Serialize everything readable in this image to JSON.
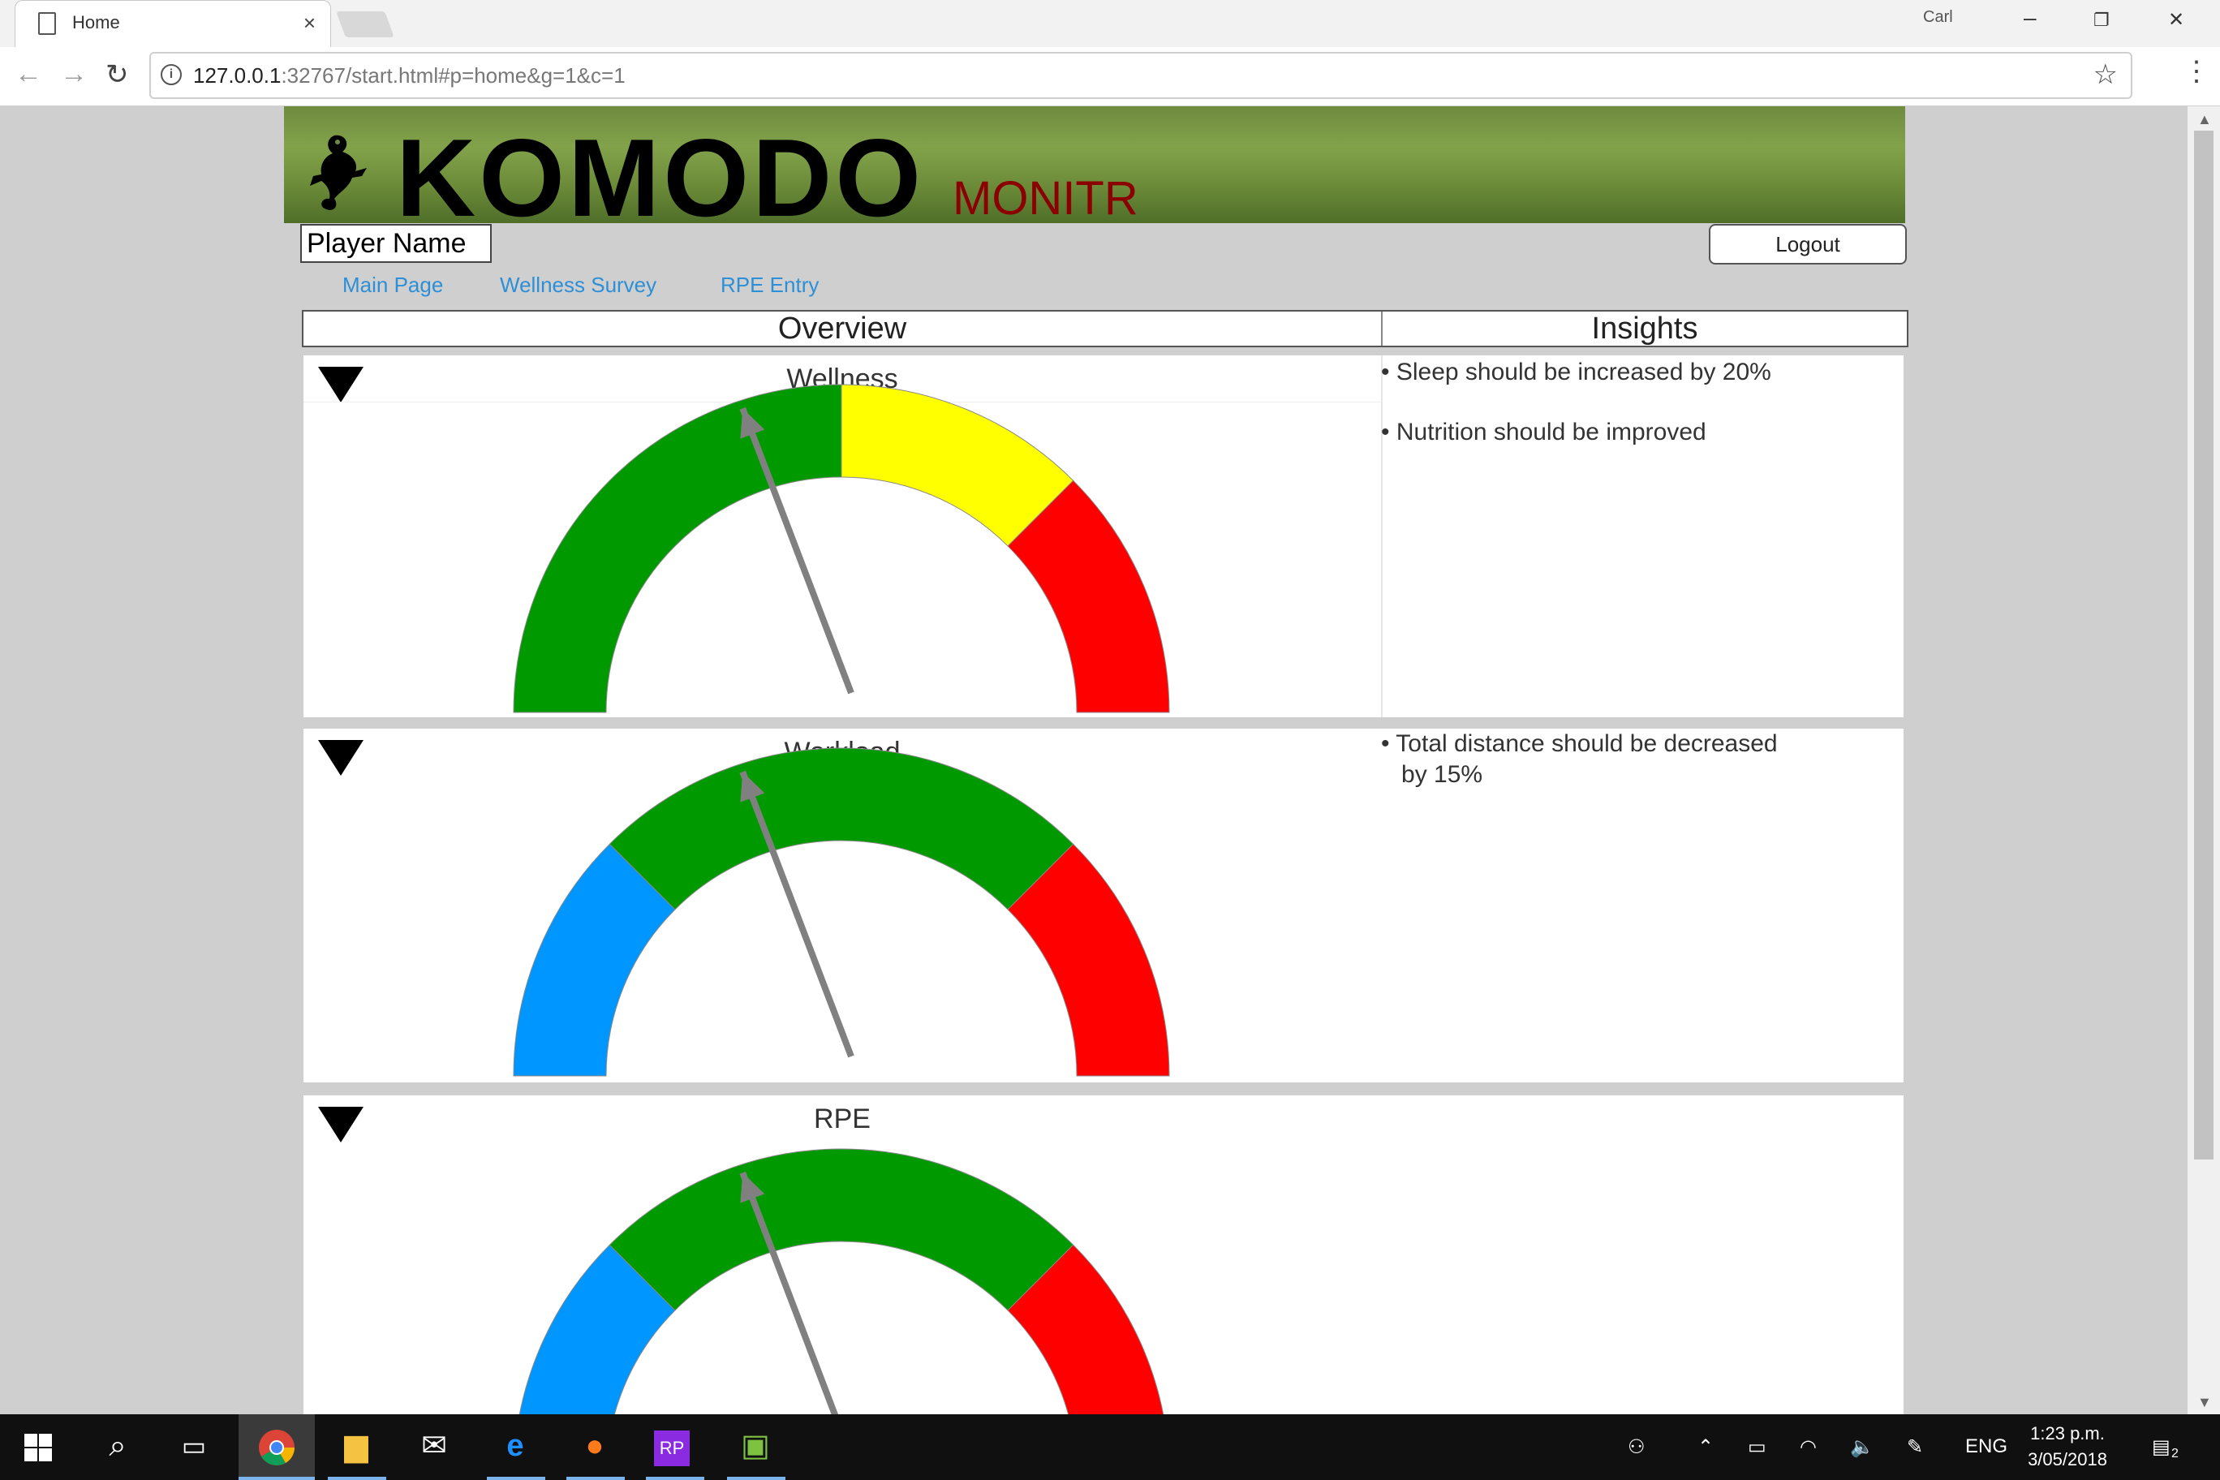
{
  "browser": {
    "tab_title": "Home",
    "tab_close": "×",
    "profile": "Carl",
    "url_host": "127.0.0.1",
    "url_rest": ":32767/start.html#p=home&g=1&c=1",
    "window_min": "–",
    "window_restore": "❐",
    "window_close": "✕",
    "back": "←",
    "forward": "→",
    "reload": "↻",
    "bookmark_star": "☆",
    "menu": "⋮"
  },
  "header": {
    "brand": "KOMODO",
    "sub": "MONITR",
    "player_name": "Player Name",
    "logout": "Logout"
  },
  "nav": {
    "items": [
      {
        "label": "Main Page"
      },
      {
        "label": "Wellness Survey"
      },
      {
        "label": "RPE Entry"
      }
    ]
  },
  "columns": {
    "overview": "Overview",
    "insights": "Insights"
  },
  "panels": [
    {
      "title": "Wellness",
      "needle_fraction": 0.4,
      "bands": [
        {
          "color": "#009900",
          "from": 0.0,
          "to": 0.5
        },
        {
          "color": "#ffff00",
          "from": 0.5,
          "to": 0.75
        },
        {
          "color": "#ff0000",
          "from": 0.75,
          "to": 1.0
        }
      ],
      "insights": [
        "• Sleep should be increased by 20%",
        "•  Nutrition should be improved"
      ]
    },
    {
      "title": "Workload",
      "needle_fraction": 0.4,
      "bands": [
        {
          "color": "#0096ff",
          "from": 0.0,
          "to": 0.25
        },
        {
          "color": "#009900",
          "from": 0.25,
          "to": 0.75
        },
        {
          "color": "#ff0000",
          "from": 0.75,
          "to": 1.0
        }
      ],
      "insights": [
        "• Total distance should be decreased",
        "   by 15%"
      ]
    },
    {
      "title": "RPE",
      "needle_fraction": 0.4,
      "bands": [
        {
          "color": "#0096ff",
          "from": 0.0,
          "to": 0.25
        },
        {
          "color": "#009900",
          "from": 0.25,
          "to": 0.75
        },
        {
          "color": "#ff0000",
          "from": 0.75,
          "to": 1.0
        }
      ],
      "insights": []
    }
  ],
  "colors": {
    "needle": "#808080",
    "link": "#2d8fd6",
    "sub_brand": "#8b0000"
  },
  "taskbar": {
    "lang": "ENG",
    "time": "1:23 p.m.",
    "date": "3/05/2018",
    "notifications": "2",
    "apps": [
      "windows-icon",
      "search-icon",
      "task-view-icon",
      "chrome-icon",
      "file-explorer-icon",
      "mail-icon",
      "edge-icon",
      "app-orange-icon",
      "rp-app-icon",
      "app-green-icon"
    ]
  }
}
